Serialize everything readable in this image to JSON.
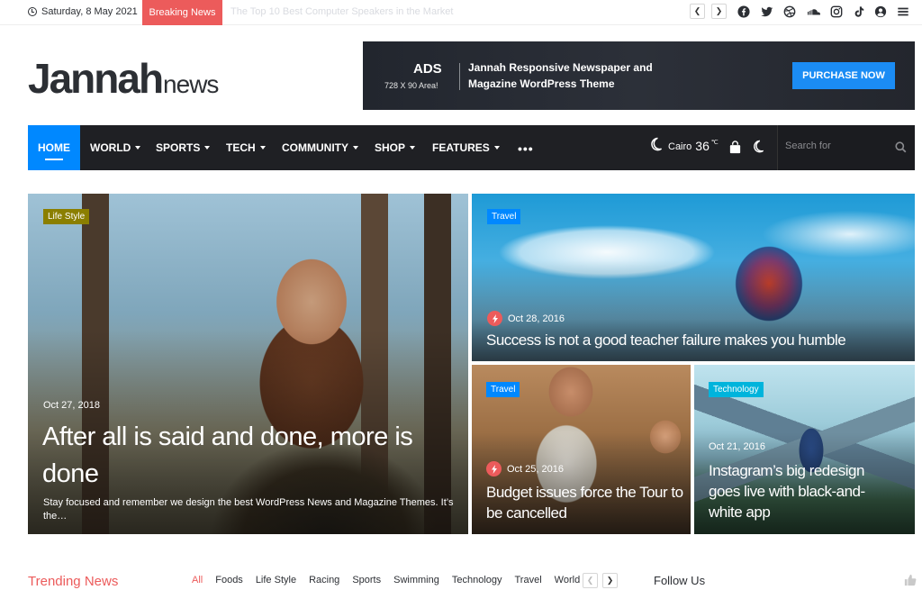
{
  "topbar": {
    "date": "Saturday, 8 May 2021",
    "breaking_label": "Breaking News",
    "breaking_headline": "The Top 10 Best Computer Speakers in the Market",
    "social_icons": [
      "facebook-icon",
      "twitter-icon",
      "dribbble-icon",
      "soundcloud-icon",
      "instagram-icon",
      "tiktok-icon",
      "user-icon",
      "menu-icon"
    ]
  },
  "header": {
    "logo_main": "Jannah",
    "logo_sub": "news",
    "ad": {
      "title": "ADS",
      "size": "728 X 90 Area!",
      "description": "Jannah Responsive Newspaper and Magazine WordPress Theme",
      "button": "PURCHASE NOW"
    }
  },
  "nav": {
    "items": [
      {
        "label": "HOME",
        "active": true
      },
      {
        "label": "WORLD"
      },
      {
        "label": "SPORTS"
      },
      {
        "label": "TECH"
      },
      {
        "label": "COMMUNITY"
      },
      {
        "label": "SHOP"
      },
      {
        "label": "FEATURES"
      }
    ],
    "more": "•••",
    "weather_city": "Cairo",
    "weather_temp": "36",
    "weather_unit": "℃",
    "search_placeholder": "Search for"
  },
  "colors": {
    "accent_red": "#ec5b5b",
    "nav_bg": "#1f2024",
    "home_blue": "#0088ff",
    "badge_blue": "#0088ff",
    "badge_lifestyle": "#8b7f00",
    "badge_technology": "#00b4dc"
  },
  "posts": {
    "main": {
      "category": "Life Style",
      "date": "Oct 27, 2018",
      "title": "After all is said and done, more is done",
      "excerpt": "Stay focused and remember we design the best WordPress News and Magazine Themes. It’s the…"
    },
    "top_right": {
      "category": "Travel",
      "date": "Oct 28, 2016",
      "title": "Success is not a good teacher failure makes you humble"
    },
    "bottom_mid": {
      "category": "Travel",
      "date": "Oct 25, 2016",
      "title": "Budget issues force the Tour to be cancelled"
    },
    "bottom_right": {
      "category": "Technology",
      "date": "Oct 21, 2016",
      "title": "Instagram’s big redesign goes live with black-and-white app"
    }
  },
  "bottom": {
    "trending_title": "Trending News",
    "filters": [
      "All",
      "Foods",
      "Life Style",
      "Racing",
      "Sports",
      "Swimming",
      "Technology",
      "Travel",
      "World"
    ],
    "follow_title": "Follow Us"
  }
}
